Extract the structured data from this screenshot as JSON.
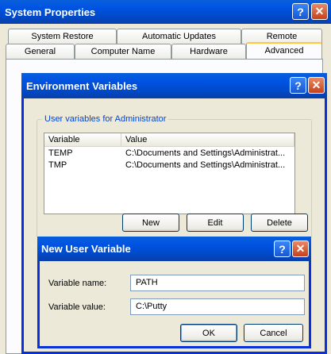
{
  "sysprops": {
    "title": "System Properties",
    "tabs_back": [
      "System Restore",
      "Automatic Updates",
      "Remote"
    ],
    "tabs_front": [
      "General",
      "Computer Name",
      "Hardware",
      "Advanced"
    ]
  },
  "envvars": {
    "title": "Environment Variables",
    "group_label": "User variables for Administrator",
    "columns": [
      "Variable",
      "Value"
    ],
    "rows": [
      {
        "variable": "TEMP",
        "value": "C:\\Documents and Settings\\Administrat..."
      },
      {
        "variable": "TMP",
        "value": "C:\\Documents and Settings\\Administrat..."
      }
    ],
    "buttons": {
      "new": "New",
      "edit": "Edit",
      "delete": "Delete"
    }
  },
  "newvar": {
    "title": "New User Variable",
    "name_label": "Variable name:",
    "name_value": "PATH",
    "value_label": "Variable value:",
    "value_value": "C:\\Putty",
    "ok": "OK",
    "cancel": "Cancel"
  },
  "titlebar_buttons": {
    "help": "?",
    "close": "✕"
  }
}
